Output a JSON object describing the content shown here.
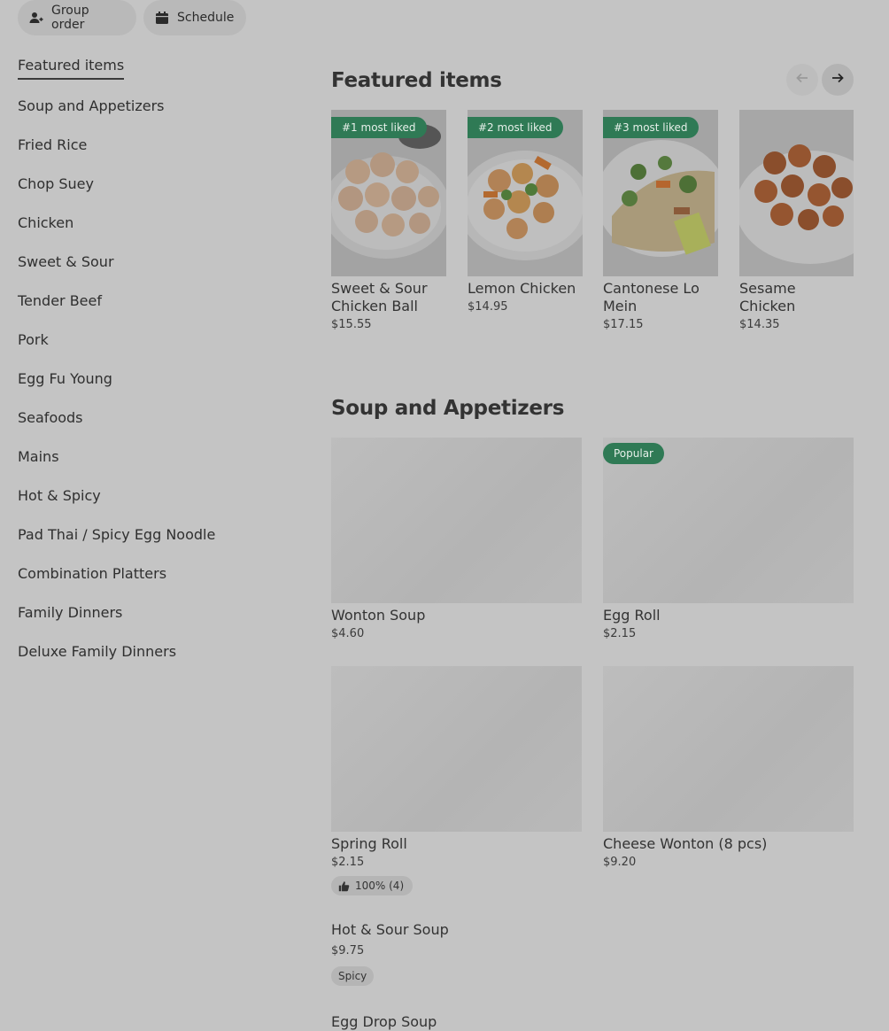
{
  "header": {
    "group_order_label": "Group order",
    "schedule_label": "Schedule"
  },
  "sidebar": {
    "items": [
      {
        "label": "Featured items"
      },
      {
        "label": "Soup and Appetizers"
      },
      {
        "label": "Fried Rice"
      },
      {
        "label": "Chop Suey"
      },
      {
        "label": "Chicken"
      },
      {
        "label": "Sweet & Sour"
      },
      {
        "label": "Tender Beef"
      },
      {
        "label": "Pork"
      },
      {
        "label": "Egg Fu Young"
      },
      {
        "label": "Seafoods"
      },
      {
        "label": "Mains"
      },
      {
        "label": "Hot & Spicy"
      },
      {
        "label": "Pad Thai / Spicy Egg Noodle"
      },
      {
        "label": "Combination Platters"
      },
      {
        "label": "Family Dinners"
      },
      {
        "label": "Deluxe Family Dinners"
      }
    ]
  },
  "featured": {
    "title": "Featured items",
    "items": [
      {
        "badge": "#1 most liked",
        "name": "Sweet & Sour Chicken Ball",
        "price": "$15.55"
      },
      {
        "badge": "#2 most liked",
        "name": "Lemon Chicken",
        "price": "$14.95"
      },
      {
        "badge": "#3 most liked",
        "name": "Cantonese Lo Mein",
        "price": "$17.15"
      },
      {
        "name": "Sesame Chicken",
        "price": "$14.35"
      }
    ]
  },
  "soup": {
    "title": "Soup and Appetizers",
    "items": [
      {
        "name": "Wonton Soup",
        "price": "$4.60"
      },
      {
        "badge": "Popular",
        "name": "Egg Roll",
        "price": "$2.15"
      },
      {
        "name": "Spring Roll",
        "price": "$2.15",
        "rating": "100% (4)"
      },
      {
        "name": "Cheese Wonton (8 pcs)",
        "price": "$9.20"
      },
      {
        "name": "Hot & Sour Soup",
        "price": "$9.75",
        "tag": "Spicy"
      },
      {
        "name": "Egg Drop Soup"
      }
    ]
  },
  "colors": {
    "badge_green": "#2f7a55",
    "overlay_gray": "#c4c4c4"
  },
  "icons": {
    "group_order": "person-plus-icon",
    "schedule": "calendar-icon",
    "prev": "arrow-left-icon",
    "next": "arrow-right-icon",
    "rating": "thumbs-up-icon"
  }
}
